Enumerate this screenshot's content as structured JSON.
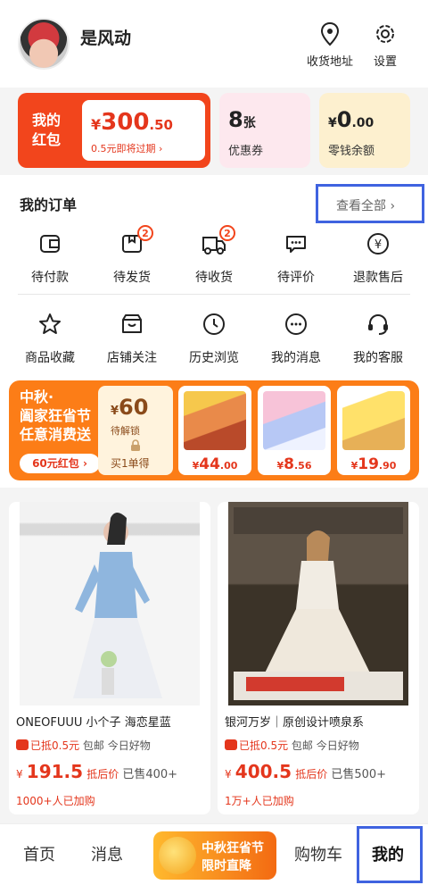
{
  "header": {
    "username": "是风动",
    "address_label": "收货地址",
    "settings_label": "设置"
  },
  "wallet": {
    "red_packet": {
      "label": "我的红包",
      "currency": "¥",
      "amount_int": "300",
      "amount_dec": ".50",
      "expiry": "0.5元即将过期 ›"
    },
    "coupons": {
      "count": "8",
      "unit": "张",
      "label": "优惠券"
    },
    "change": {
      "currency": "¥",
      "amount_int": "0",
      "amount_dec": ".00",
      "label": "零钱余额"
    }
  },
  "orders": {
    "title": "我的订单",
    "view_all": "查看全部 ›",
    "status_items": [
      {
        "label": "待付款",
        "icon": "wallet-icon",
        "badge": ""
      },
      {
        "label": "待发货",
        "icon": "package-icon",
        "badge": "2"
      },
      {
        "label": "待收货",
        "icon": "truck-icon",
        "badge": "2"
      },
      {
        "label": "待评价",
        "icon": "comment-icon",
        "badge": ""
      },
      {
        "label": "退款售后",
        "icon": "refund-icon",
        "badge": ""
      }
    ],
    "tools": [
      {
        "label": "商品收藏",
        "icon": "star-icon"
      },
      {
        "label": "店铺关注",
        "icon": "store-icon"
      },
      {
        "label": "历史浏览",
        "icon": "clock-icon"
      },
      {
        "label": "我的消息",
        "icon": "message-icon"
      },
      {
        "label": "我的客服",
        "icon": "headset-icon"
      }
    ]
  },
  "promo": {
    "title_line1": "中秋·",
    "title_line2": "阖家狂省节",
    "title_line3": "任意消费送",
    "coupon_button": "60元红包 ›",
    "lock_currency": "¥",
    "lock_amount": "60",
    "lock_label": "待解锁",
    "lock_action": "买1单得",
    "products": [
      {
        "price_int": "44",
        "price_dec": ".00",
        "image": "instant-noodles"
      },
      {
        "price_int": "8",
        "price_dec": ".56",
        "image": "toilet-cleaner"
      },
      {
        "price_int": "19",
        "price_dec": ".90",
        "image": "cake-box"
      }
    ],
    "currency": "¥"
  },
  "feed": [
    {
      "title": "ONEOFUUU 小个子 海恋星蓝",
      "subsidy": "已抵0.5元",
      "shipping": "包邮 今日好物",
      "currency": "¥",
      "price": "191.5",
      "price_tag": "抵后价",
      "sold": "已售400+",
      "social": "1000+人已加购"
    },
    {
      "title": "银河万岁｜原创设计喷泉系",
      "subsidy": "已抵0.5元",
      "shipping": "包邮 今日好物",
      "currency": "¥",
      "price": "400.5",
      "price_tag": "抵后价",
      "sold": "已售500+",
      "social": "1万+人已加购"
    }
  ],
  "tabbar": {
    "home": "首页",
    "messages": "消息",
    "promo_line1": "中秋狂省节",
    "promo_line2": "限时直降",
    "cart": "购物车",
    "me": "我的"
  },
  "colors": {
    "accent_red": "#f2451c",
    "promo_orange": "#fc7d17",
    "highlight_blue": "#3f63e0"
  }
}
